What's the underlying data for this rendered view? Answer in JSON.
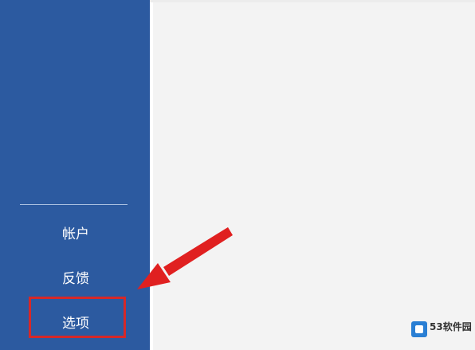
{
  "sidebar": {
    "items": [
      {
        "label": "帐户"
      },
      {
        "label": "反馈"
      },
      {
        "label": "选项"
      }
    ]
  },
  "watermark": {
    "text": "53软件园"
  },
  "colors": {
    "sidebar": "#2c5aa0",
    "highlight": "#d62828",
    "arrow": "#e02020"
  }
}
